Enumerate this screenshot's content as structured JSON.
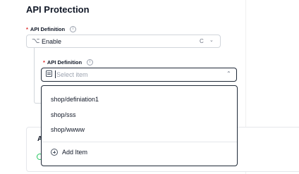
{
  "section": {
    "title": "API Protection"
  },
  "outer_field": {
    "label": "API Definition",
    "required_mark": "*",
    "value": "Enable",
    "info_icon": "info-icon",
    "branch_icon": "branch-icon",
    "refresh_icon": "refresh-icon"
  },
  "inner_field": {
    "label": "API Definition",
    "required_mark": "*",
    "placeholder": "Select item",
    "info_icon": "info-icon"
  },
  "dropdown": {
    "items": [
      "shop/definiation1",
      "shop/sss",
      "shop/wwww"
    ],
    "add_label": "Add Item"
  },
  "background_card": {
    "fragment_text": "A"
  },
  "colors": {
    "required": "#dc2626",
    "focus_border": "#1f2937",
    "success": "#22c55e"
  }
}
